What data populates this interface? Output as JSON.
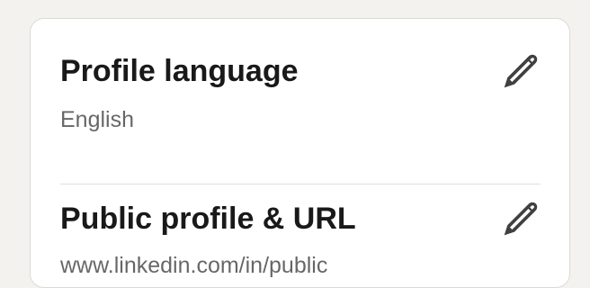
{
  "sections": [
    {
      "title": "Profile language",
      "value": "English",
      "action_icon": "pencil-icon"
    },
    {
      "title": "Public profile & URL",
      "value": "www.linkedin.com/in/public",
      "action_icon": "pencil-icon"
    }
  ],
  "colors": {
    "background": "#f4f2ee",
    "card": "#ffffff",
    "title_text": "#1a1a1a",
    "secondary_text": "#666666"
  }
}
